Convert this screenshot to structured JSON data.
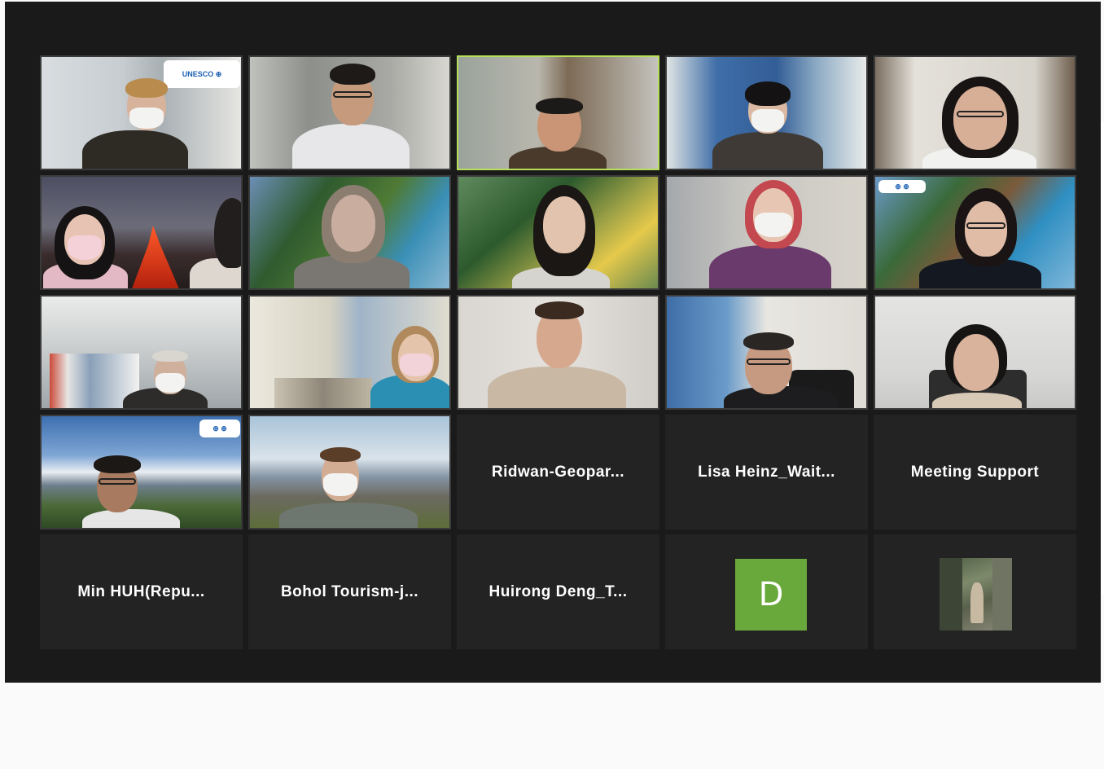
{
  "meeting": {
    "participants": [
      {
        "type": "video",
        "active": false,
        "badge": "unesco"
      },
      {
        "type": "video",
        "active": false
      },
      {
        "type": "video",
        "active": true
      },
      {
        "type": "video",
        "active": false
      },
      {
        "type": "video",
        "active": false
      },
      {
        "type": "video",
        "active": false
      },
      {
        "type": "video",
        "active": false
      },
      {
        "type": "video",
        "active": false
      },
      {
        "type": "video",
        "active": false
      },
      {
        "type": "video",
        "active": false
      },
      {
        "type": "video",
        "active": false
      },
      {
        "type": "video",
        "active": false
      },
      {
        "type": "video",
        "active": false
      },
      {
        "type": "video",
        "active": false
      },
      {
        "type": "video",
        "active": false
      },
      {
        "type": "video",
        "active": false
      },
      {
        "type": "video",
        "active": false
      },
      {
        "type": "name",
        "name": "Ridwan-Geopar..."
      },
      {
        "type": "name",
        "name": "Lisa  Heinz_Wait..."
      },
      {
        "type": "name",
        "name": "Meeting Support"
      },
      {
        "type": "name",
        "name": "Min  HUH(Repu..."
      },
      {
        "type": "name",
        "name": "Bohol  Tourism-j..."
      },
      {
        "type": "name",
        "name": "Huirong Deng_T..."
      },
      {
        "type": "initial",
        "initial": "D",
        "color": "#69a83a"
      },
      {
        "type": "photo"
      }
    ]
  },
  "colors": {
    "background": "#1a1a1a",
    "tile": "#232323",
    "active_speaker_border": "#b7e05a",
    "name_text": "#ffffff"
  },
  "icons": {
    "avatar_photo": "profile-photo-icon"
  }
}
